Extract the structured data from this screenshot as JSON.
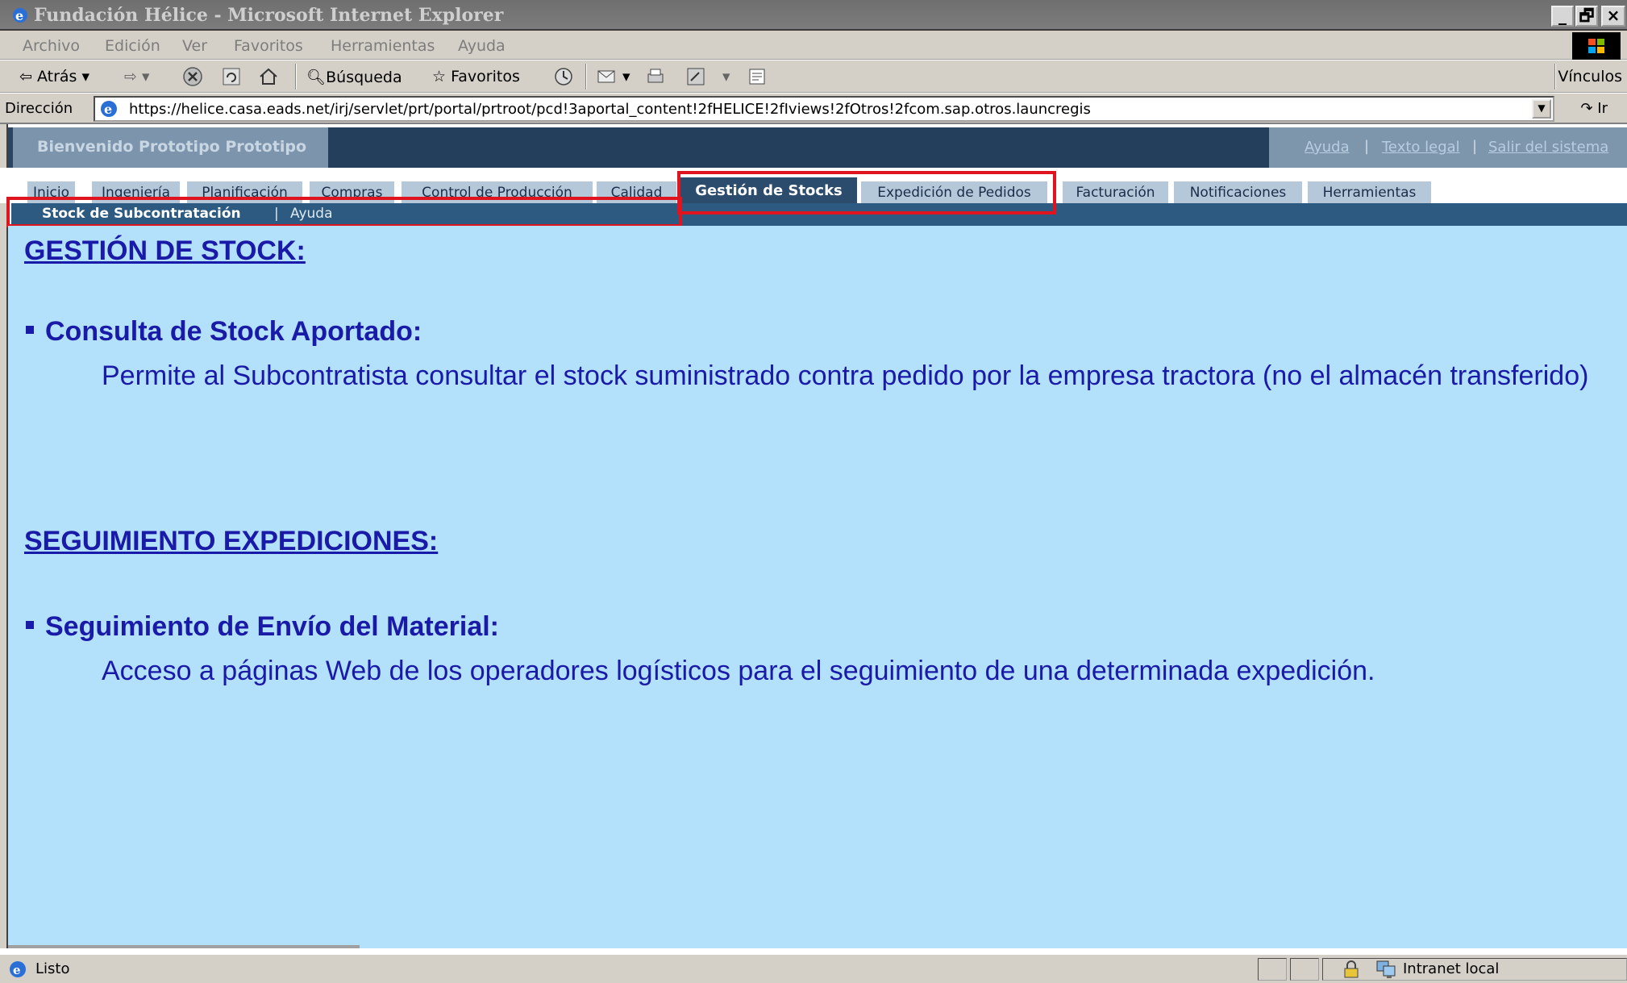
{
  "window": {
    "title": "Fundación Hélice - Microsoft Internet Explorer",
    "minimize_label": "_",
    "maximize_label": "🗗",
    "close_label": "×"
  },
  "menu": [
    "Archivo",
    "Edición",
    "Ver",
    "Favoritos",
    "Herramientas",
    "Ayuda"
  ],
  "toolbar": {
    "back_label": "Atrás",
    "search_label": "Búsqueda",
    "favorites_label": "Favoritos",
    "links_label": "Vínculos"
  },
  "address": {
    "label": "Dirección",
    "url": "https://helice.casa.eads.net/irj/servlet/prt/portal/prtroot/pcd!3aportal_content!2fHELICE!2fIviews!2fOtros!2fcom.sap.otros.launcregis",
    "go_label": "Ir"
  },
  "portal": {
    "welcome": "Bienvenido Prototipo Prototipo",
    "links": [
      "Ayuda",
      "Texto legal",
      "Salir del sistema"
    ],
    "separator": "|"
  },
  "tabs": [
    {
      "label": "Inicio"
    },
    {
      "label": "Ingeniería"
    },
    {
      "label": "Planificación"
    },
    {
      "label": "Compras"
    },
    {
      "label": "Control de Producción"
    },
    {
      "label": "Calidad"
    },
    {
      "label": "Gestión de Stocks",
      "active": true
    },
    {
      "label": "Expedición de Pedidos"
    },
    {
      "label": "Facturación"
    },
    {
      "label": "Notificaciones"
    },
    {
      "label": "Herramientas"
    }
  ],
  "subnav": {
    "item": "Stock de Subcontratación",
    "separator": "|",
    "help": "Ayuda"
  },
  "content": {
    "section1_title": "GESTIÓN DE STOCK:",
    "section1_item": "Consulta de Stock Aportado:",
    "section1_text": "Permite al Subcontratista consultar el stock suministrado contra pedido por la empresa tractora (no el almacén transferido)",
    "section2_title": "SEGUIMIENTO EXPEDICIONES:",
    "section2_item": "Seguimiento de Envío del Material:",
    "section2_text": "Acceso a páginas Web de los operadores logísticos para el seguimiento de una determinada expedición."
  },
  "status": {
    "text": "Listo",
    "zone": "Intranet local"
  },
  "colors": {
    "content_bg": "#b3e0fa",
    "content_text": "#1a1aa8",
    "highlight_box": "#e0141e",
    "active_tab": "#2c4c6e"
  }
}
